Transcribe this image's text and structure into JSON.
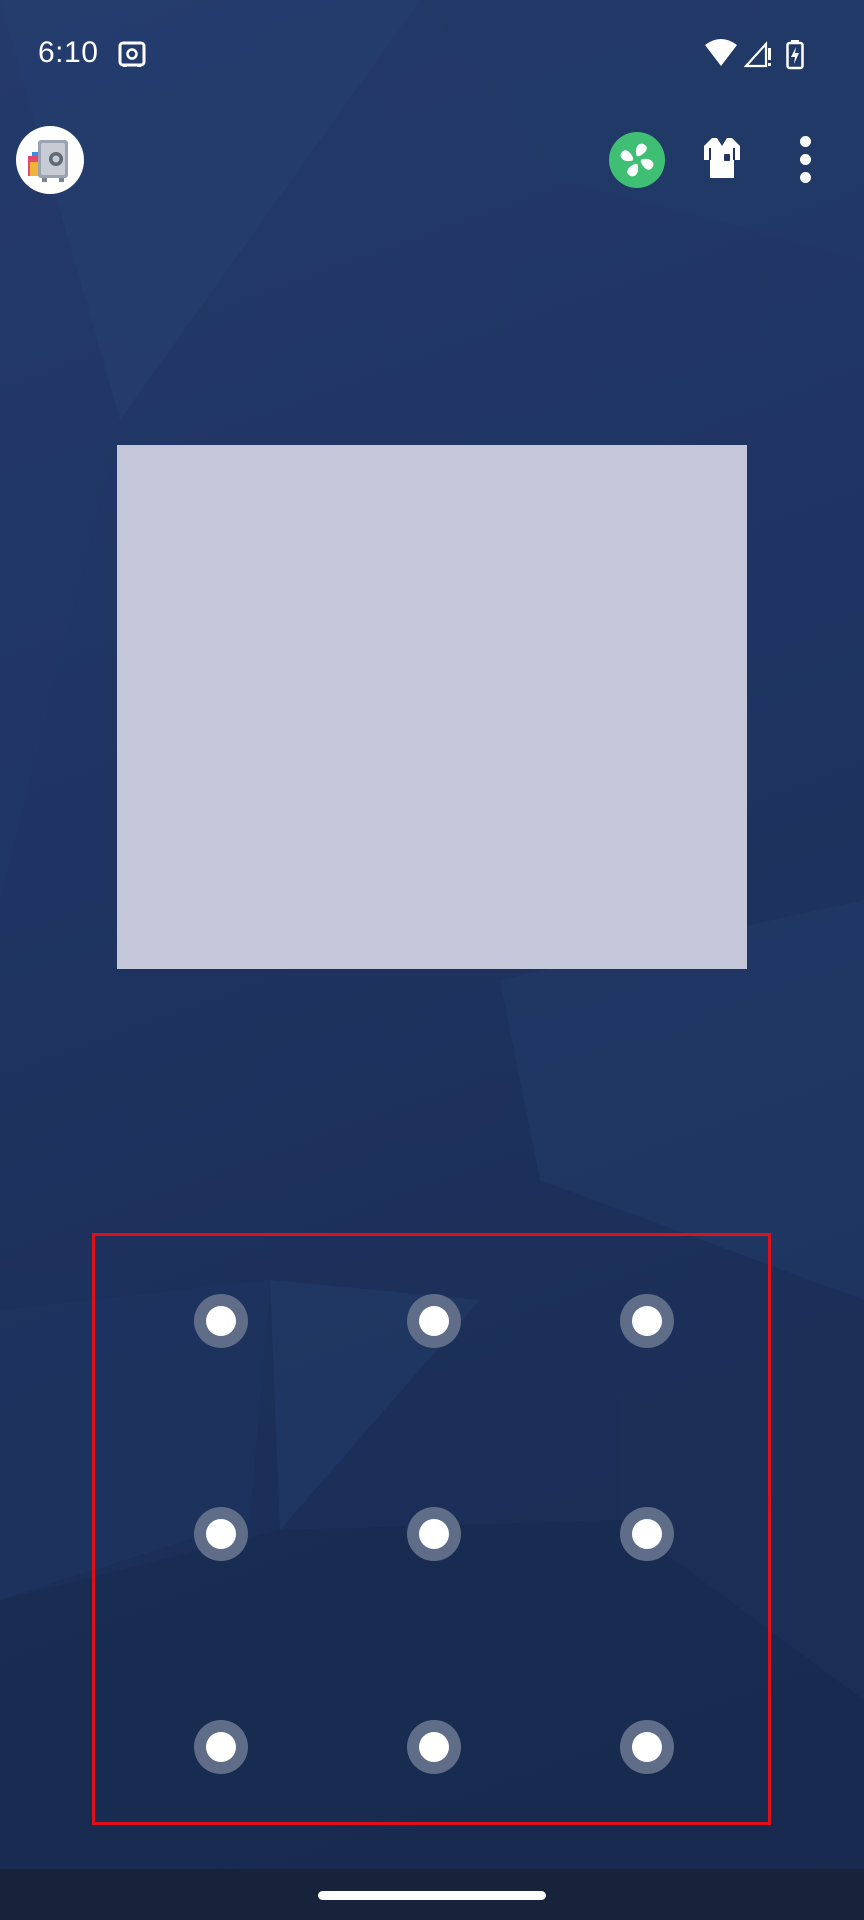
{
  "status_bar": {
    "time": "6:10",
    "icons": [
      "vault-notification-icon",
      "wifi-icon",
      "cellular-signal-icon",
      "battery-charging-icon"
    ]
  },
  "toolbar": {
    "app_icon": "app-lock-vault-icon",
    "actions": [
      "fan-boost-icon",
      "theme-shirt-icon",
      "more-options-icon"
    ]
  },
  "ad_panel": {
    "color": "#c4c7da"
  },
  "pattern_lock": {
    "rows": 3,
    "columns": 3,
    "dots": [
      1,
      2,
      3,
      4,
      5,
      6,
      7,
      8,
      9
    ],
    "dot_color": "#ffffff",
    "ring_color": "#5f6d88",
    "highlight_color": "#e0101b"
  },
  "colors": {
    "background": "#1f3461",
    "accent_fan": "#3fbf74",
    "nav_bar": "#17233b"
  }
}
